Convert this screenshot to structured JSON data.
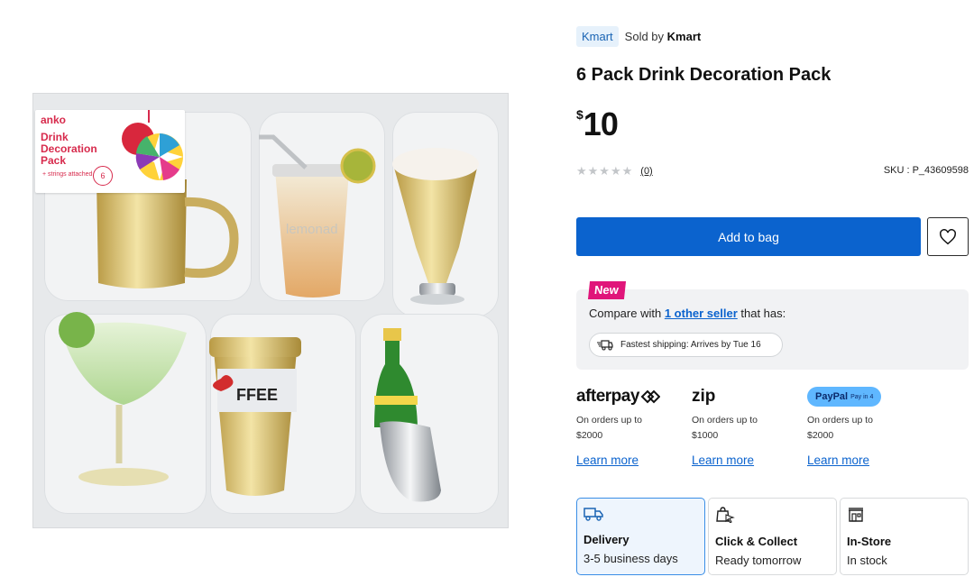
{
  "image": {
    "label_brand": "anko",
    "label_title": "Drink Decoration Pack",
    "label_sub": "+ strings attached",
    "label_count": "6",
    "cup_print": "lemonad",
    "coffee_print": "FFEE"
  },
  "seller": {
    "badge": "Kmart",
    "sold_by_prefix": "Sold by",
    "sold_by_name": "Kmart"
  },
  "product": {
    "title": "6 Pack Drink Decoration Pack",
    "price_currency": "$",
    "price_amount": "10",
    "rating_stars": "★★★★★",
    "review_count": "(0)",
    "sku": "SKU : P_43609598"
  },
  "actions": {
    "add_to_bag": "Add to bag"
  },
  "compare": {
    "badge": "New",
    "text_prefix": "Compare with",
    "link": "1 other seller",
    "text_suffix": "that has:",
    "shipping": "Fastest shipping: Arrives by Tue 16"
  },
  "bnpl": [
    {
      "logo": "afterpay",
      "line1": "On orders up to",
      "line2": "$2000",
      "learn": "Learn more"
    },
    {
      "logo": "zip",
      "line1": "On orders up to",
      "line2": "$1000",
      "learn": "Learn more"
    },
    {
      "logo": "PayPal",
      "logo_sub": "Pay in 4",
      "line1": "On orders up to",
      "line2": "$2000",
      "learn": "Learn more"
    }
  ],
  "delivery": [
    {
      "title": "Delivery",
      "sub": "3-5 business days",
      "icon": "truck-icon",
      "selected": true
    },
    {
      "title": "Click & Collect",
      "sub": "Ready tomorrow",
      "icon": "bag-cursor-icon",
      "selected": false
    },
    {
      "title": "In-Store",
      "sub": "In stock",
      "icon": "store-icon",
      "selected": false
    }
  ],
  "colors": {
    "primary": "#0b63ce",
    "new_badge": "#e0157a",
    "label_red": "#d72a4c"
  }
}
